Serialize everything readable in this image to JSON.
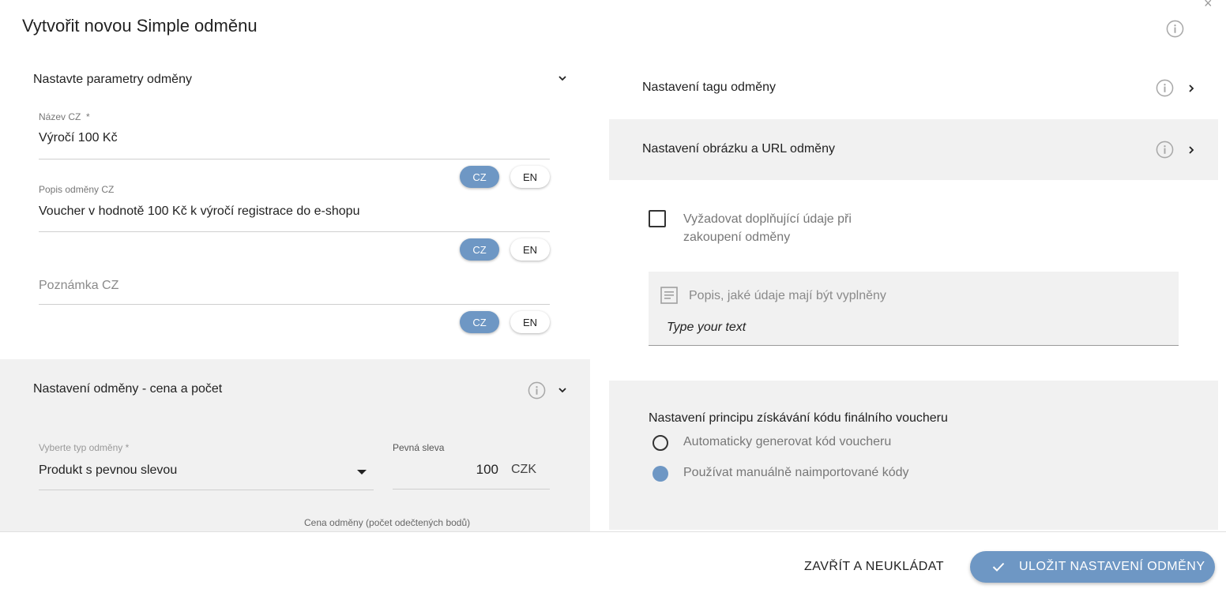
{
  "dialog": {
    "title": "Vytvořit novou Simple odměnu",
    "close_glyph": "×"
  },
  "params_section": {
    "header": "Nastavte parametry odměny",
    "name_label": "Název CZ",
    "name_required": "*",
    "name_value": "Výročí 100 Kč",
    "desc_label": "Popis odměny CZ",
    "desc_value": "Voucher v hodnotě 100 Kč k výročí registrace do e-shopu",
    "note_placeholder": "Poznámka CZ",
    "lang_cz": "CZ",
    "lang_en": "EN"
  },
  "price_section": {
    "header": "Nastavení odměny - cena a počet",
    "type_label": "Vyberte typ odměny *",
    "type_value": "Produkt s pevnou slevou",
    "discount_label": "Pevná sleva",
    "discount_value": "100",
    "discount_unit": "CZK",
    "points_label": "Cena odměny (počet odečtených bodů)"
  },
  "right": {
    "tag_row": "Nastavení tagu odměny",
    "image_row": "Nastavení obrázku a URL odměny",
    "checkbox_label_line1": "Vyžadovat doplňující údaje při",
    "checkbox_label_line2": "zakoupení odměny",
    "textarea_placeholder": "Popis, jaké údaje mají být vyplněny",
    "textarea_value": "Type your text",
    "voucher_heading": "Nastavení principu získávání kódu finálního voucheru",
    "radio_auto": "Automaticky generovat kód voucheru",
    "radio_manual": "Používat manuálně naimportované kódy",
    "radio_selected": "manual",
    "checkbox_checked": false
  },
  "footer": {
    "cancel_label": "ZAVŘÍT A NEUKLÁDAT",
    "save_label": "ULOŽIT NASTAVENÍ ODMĚNY"
  },
  "colors": {
    "accent": "#6e97c4",
    "panel_gray": "#f1f1f1"
  }
}
